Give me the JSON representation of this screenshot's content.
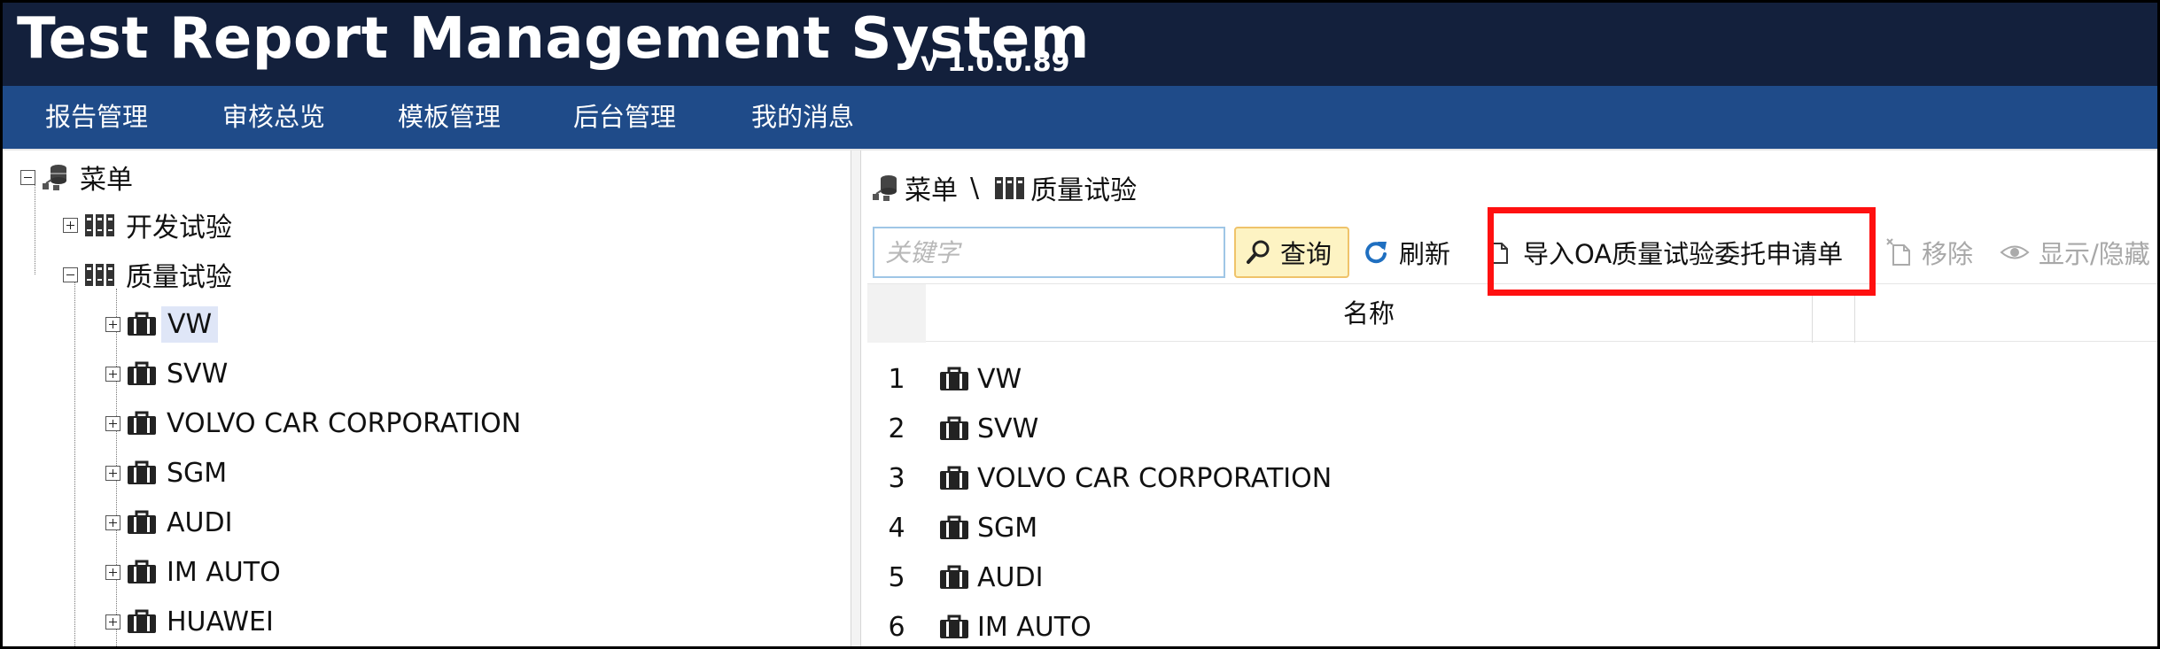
{
  "app": {
    "title": "Test Report Management System",
    "version": "v 1.0.0.89"
  },
  "menu": {
    "items": [
      {
        "label": "报告管理"
      },
      {
        "label": "审核总览"
      },
      {
        "label": "模板管理"
      },
      {
        "label": "后台管理"
      },
      {
        "label": "我的消息"
      }
    ]
  },
  "tree": {
    "root": {
      "label": "菜单",
      "icon": "database-icon",
      "expanded": true
    },
    "nodes": [
      {
        "label": "开发试验",
        "icon": "books-icon",
        "expanded": false,
        "level": 1
      },
      {
        "label": "质量试验",
        "icon": "books-icon",
        "expanded": true,
        "level": 1
      },
      {
        "label": "VW",
        "icon": "briefcase-icon",
        "expanded": false,
        "level": 2,
        "selected": true
      },
      {
        "label": "SVW",
        "icon": "briefcase-icon",
        "expanded": false,
        "level": 2
      },
      {
        "label": "VOLVO CAR CORPORATION",
        "icon": "briefcase-icon",
        "expanded": false,
        "level": 2
      },
      {
        "label": "SGM",
        "icon": "briefcase-icon",
        "expanded": false,
        "level": 2
      },
      {
        "label": "AUDI",
        "icon": "briefcase-icon",
        "expanded": false,
        "level": 2
      },
      {
        "label": "IM AUTO",
        "icon": "briefcase-icon",
        "expanded": false,
        "level": 2
      },
      {
        "label": "HUAWEI",
        "icon": "briefcase-icon",
        "expanded": false,
        "level": 2
      }
    ]
  },
  "breadcrumb": {
    "root": "菜单",
    "separator": "\\",
    "current": "质量试验"
  },
  "toolbar": {
    "search_placeholder": "关键字",
    "search_value": "",
    "query_label": "查询",
    "refresh_label": "刷新",
    "import_label": "导入OA质量试验委托申请单",
    "remove_label": "移除",
    "toggle_label": "显示/隐藏"
  },
  "grid": {
    "columns": [
      "名称"
    ],
    "rows": [
      {
        "num": "1",
        "name": "VW"
      },
      {
        "num": "2",
        "name": "SVW"
      },
      {
        "num": "3",
        "name": "VOLVO CAR CORPORATION"
      },
      {
        "num": "4",
        "name": "SGM"
      },
      {
        "num": "5",
        "name": "AUDI"
      },
      {
        "num": "6",
        "name": "IM AUTO"
      }
    ]
  },
  "colors": {
    "header_bg": "#13203c",
    "menu_bg": "#1f4b89",
    "highlight": "#ff1010",
    "query_bg": "#fdf3c3"
  }
}
